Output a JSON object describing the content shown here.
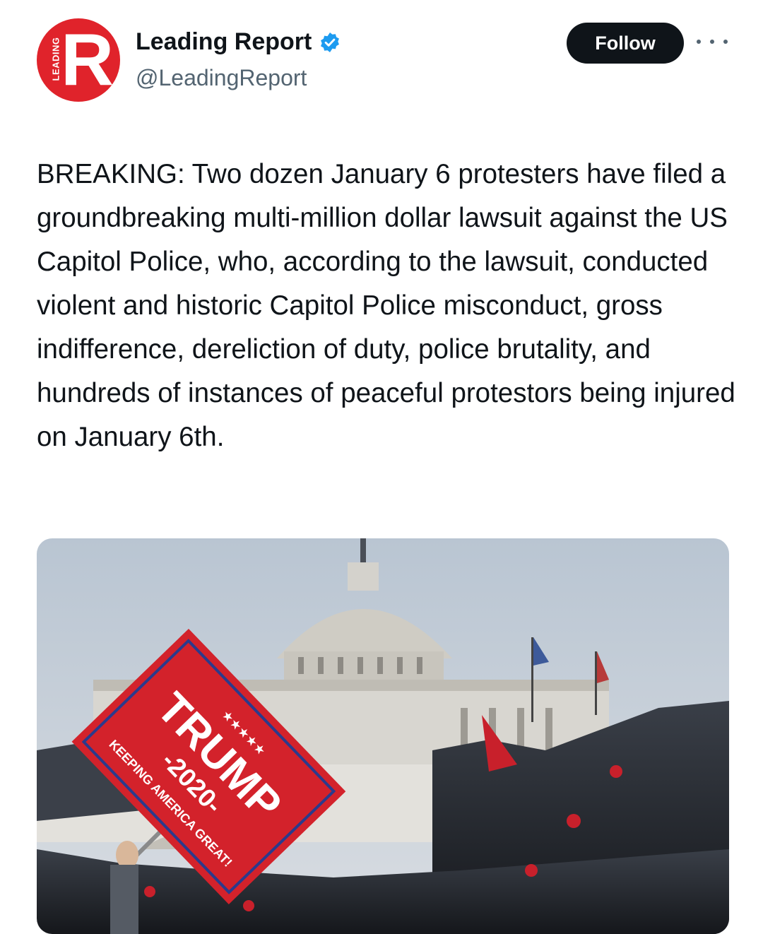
{
  "account": {
    "name": "Leading Report",
    "handle": "@LeadingReport",
    "avatar_letter": "R",
    "avatar_side_text": "LEADING",
    "verified_icon": "verified-badge-icon",
    "brand_color": "#e0232b",
    "verified_color": "#1d9bf0"
  },
  "actions": {
    "follow_label": "Follow",
    "more_icon": "more-horizontal-icon"
  },
  "tweet": {
    "text": "BREAKING: Two dozen January 6 protesters have filed a groundbreaking multi-million dollar lawsuit against the US Capitol Police, who, according to the lawsuit, conducted violent and historic Capitol Police misconduct, gross indifference, dereliction of duty, police brutality, and hundreds of instances of peaceful protestors being injured on January 6th."
  },
  "media": {
    "flag_title": "TRUMP",
    "flag_year": "-2020-",
    "flag_slogan": "KEEPING AMERICA GREAT!",
    "flag_stars": "★★★★★"
  }
}
